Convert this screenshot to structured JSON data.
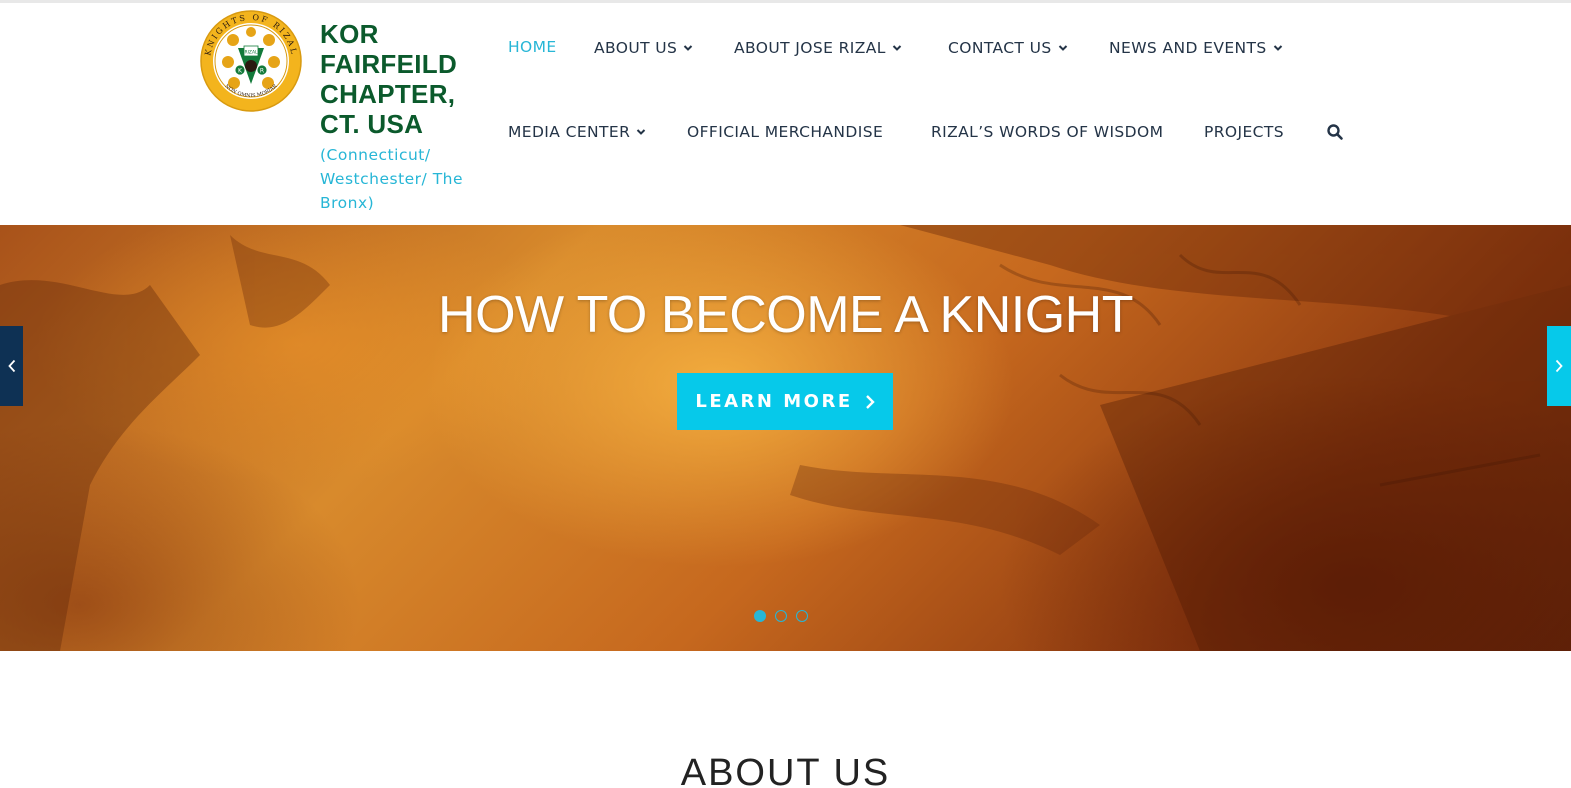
{
  "brand": {
    "title_lines": [
      "KOR",
      "FAIRFEILD",
      "CHAPTER,",
      "CT. USA"
    ],
    "subtitle_lines": [
      "(Connecticut/",
      "Westchester/ The",
      "Bronx)"
    ],
    "logo_ring_text": "KNIGHTS OF RIZAL",
    "logo_motto": "NON OMNIS MORIAR",
    "logo_center_text": "RIZAL",
    "logo_letters": [
      "K",
      "R"
    ]
  },
  "nav": {
    "row1": [
      {
        "label": "HOME",
        "active": true,
        "dropdown": false
      },
      {
        "label": "ABOUT US",
        "active": false,
        "dropdown": true
      },
      {
        "label": "ABOUT JOSE RIZAL",
        "active": false,
        "dropdown": true
      },
      {
        "label": "CONTACT US",
        "active": false,
        "dropdown": true
      },
      {
        "label": "NEWS AND EVENTS",
        "active": false,
        "dropdown": true
      }
    ],
    "row2": [
      {
        "label": "MEDIA CENTER",
        "active": false,
        "dropdown": true
      },
      {
        "label": "OFFICIAL MERCHANDISE",
        "active": false,
        "dropdown": false
      },
      {
        "label": "RIZAL’S WORDS OF WISDOM",
        "active": false,
        "dropdown": false
      },
      {
        "label": "PROJECTS",
        "active": false,
        "dropdown": false
      }
    ],
    "search_icon": "search-icon"
  },
  "hero": {
    "title": "HOW TO BECOME A KNIGHT",
    "button_label": "LEARN MORE",
    "slides_total": 3,
    "active_slide": 1
  },
  "sections": {
    "about_heading": "ABOUT US"
  },
  "colors": {
    "accent": "#06c9ea",
    "brand_green": "#0b5a2c",
    "nav_text": "#243447",
    "prev_button": "#0e3154"
  }
}
